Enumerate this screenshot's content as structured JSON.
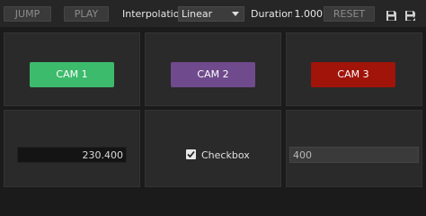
{
  "toolbar": {
    "jump_label": "JUMP",
    "play_label": "PLAY",
    "interpolation_label": "Interpolation:",
    "interpolation_value": "Linear",
    "duration_label": "Duration:",
    "duration_value": "1.000",
    "reset_label": "RESET",
    "save_icon": "save-icon",
    "save_as_icon": "save-as-icon"
  },
  "cameras": [
    {
      "label": "CAM 1",
      "color": "#3dbb6c"
    },
    {
      "label": "CAM 2",
      "color": "#6f4a8c"
    },
    {
      "label": "CAM 3",
      "color": "#a0140a"
    }
  ],
  "fields": {
    "number_value": "230.400",
    "checkbox_label": "Checkbox",
    "checkbox_checked": true,
    "text_value": "400"
  }
}
